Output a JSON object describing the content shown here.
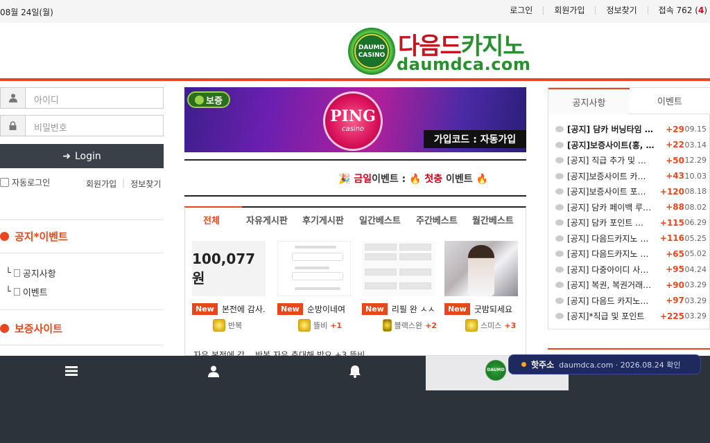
{
  "topbar": {
    "date": "08월 24일(월)",
    "links": [
      "로그인",
      "회원가입",
      "정보찾기"
    ],
    "visitors_label": "접속 762 (",
    "visitors_count": "4",
    "visitors_close": ")"
  },
  "logo": {
    "badge_line1": "DAUMD",
    "badge_line2": "CASINO",
    "title_part1": "다음드",
    "title_part2": "카지노",
    "domain": "daumdca.com"
  },
  "login": {
    "id_placeholder": "아이디",
    "pw_placeholder": "비밀번호",
    "button_label": "Login",
    "auto_login": "자동로그인",
    "join": "회원가입",
    "find": "정보찾기"
  },
  "left_menu": {
    "notice_title": "공지*이벤트",
    "items": [
      "공지사항",
      "이벤트"
    ],
    "guarantee_title": "보증사이트"
  },
  "banner": {
    "guarantee_badge": "보증",
    "brand": "PING",
    "brand_sub": "casino",
    "code_text": "가입코드 : 자동가입"
  },
  "ticker": {
    "label_red": "금일",
    "label": "이벤트 : ",
    "event_red": "첫충",
    "event": " 이벤트"
  },
  "board": {
    "tabs": [
      "전체",
      "자유게시판",
      "후기게시판",
      "일간베스트",
      "주간베스트",
      "월간베스트"
    ],
    "new_label": "New",
    "cards": [
      {
        "thumb_text": "100,077 원",
        "title": "본전에 감사.",
        "author": "반복",
        "points": ""
      },
      {
        "thumb_text": "",
        "title": "순방이네여",
        "author": "뜰비",
        "points": "+1"
      },
      {
        "thumb_text": "",
        "title": "리필 완 ㅅㅅ",
        "author": "블랙스완",
        "points": "+2"
      },
      {
        "thumb_text": "",
        "title": "굿밤되세요",
        "author": "스미스",
        "points": "+3"
      }
    ],
    "row2": "자유  본전에 감...        반복           자유  축대해 받요  +3        뜰비"
  },
  "right": {
    "tabs": [
      "공지사항",
      "이벤트"
    ],
    "notices": [
      {
        "text": "[공지] 담카 버닝타임 …",
        "points": "+29",
        "date": "09.15",
        "bold": true
      },
      {
        "text": "[공지]보증사이트(홍, …",
        "points": "+22",
        "date": "03.14",
        "bold": true
      },
      {
        "text": "[공지] 직급 추가 및 …",
        "points": "+50",
        "date": "12.29",
        "bold": false
      },
      {
        "text": "[공지]보증사이트 카…",
        "points": "+43",
        "date": "10.03",
        "bold": false
      },
      {
        "text": "[공지]보증사이트 포…",
        "points": "+120",
        "date": "08.18",
        "bold": false
      },
      {
        "text": "[공지] 담카 페이백 루…",
        "points": "+88",
        "date": "08.02",
        "bold": false
      },
      {
        "text": "[공지] 담카 포인트 …",
        "points": "+115",
        "date": "06.29",
        "bold": false
      },
      {
        "text": "[공지] 다음드카지노 …",
        "points": "+116",
        "date": "05.25",
        "bold": false
      },
      {
        "text": "[공지] 다음드카지노 …",
        "points": "+65",
        "date": "05.02",
        "bold": false
      },
      {
        "text": "[공지] 다중아이디 사…",
        "points": "+95",
        "date": "04.24",
        "bold": false
      },
      {
        "text": "[공지] 복권, 복권거래…",
        "points": "+90",
        "date": "03.29",
        "bold": false
      },
      {
        "text": "[공지] 다음드 카지노…",
        "points": "+97",
        "date": "03.29",
        "bold": false
      },
      {
        "text": "[공지]*직급 및 포인트",
        "points": "+225",
        "date": "03.29",
        "bold": false
      }
    ]
  },
  "hot": {
    "label": "핫주소",
    "url": "daumdca.com · 2026.08.24 확인"
  }
}
